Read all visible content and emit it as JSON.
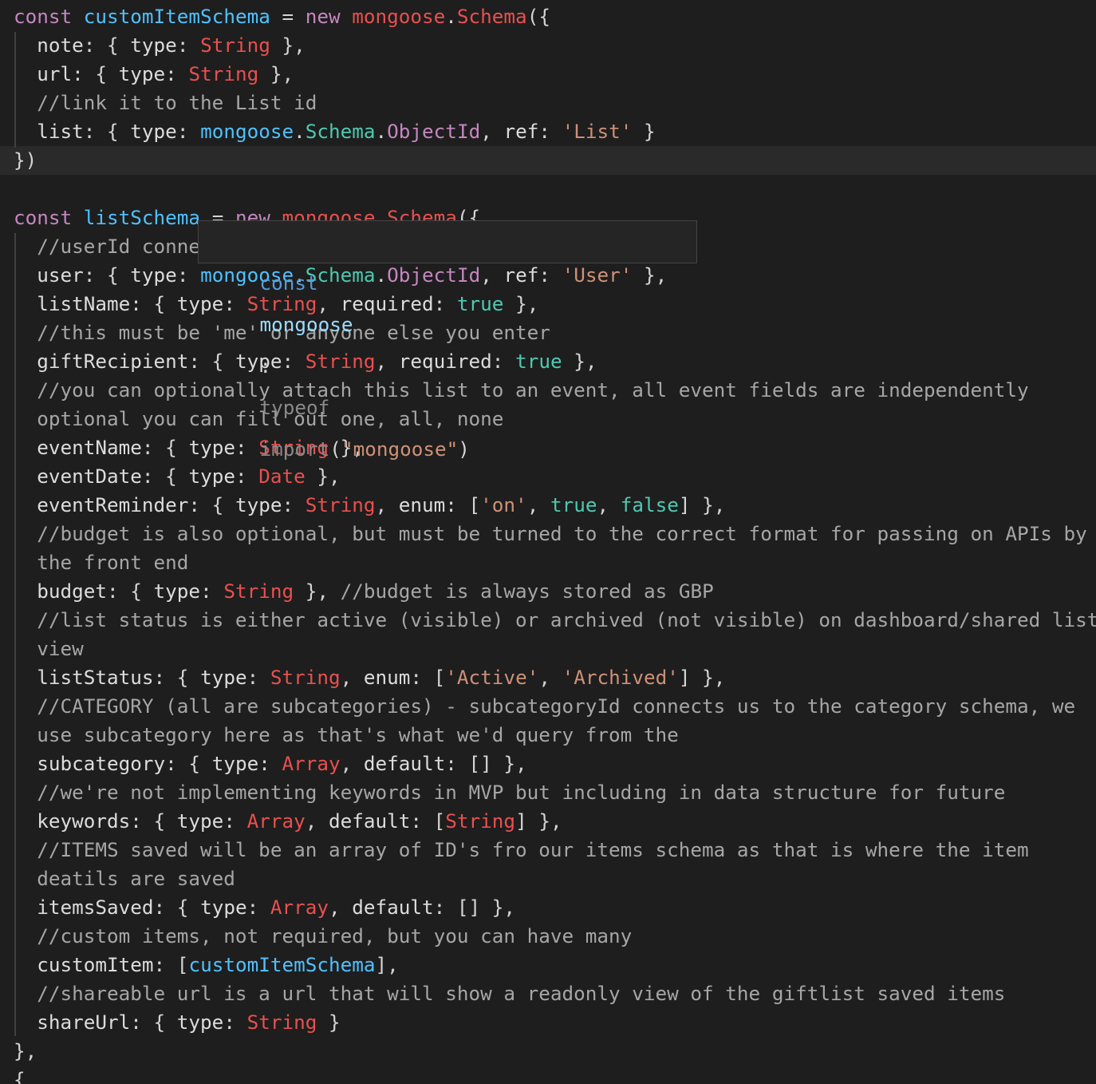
{
  "editor": {
    "lines": [
      [
        [
          "kw",
          "const "
        ],
        [
          "var",
          "customItemSchema"
        ],
        [
          "op",
          " = "
        ],
        [
          "kw",
          "new "
        ],
        [
          "cls",
          "mongoose"
        ],
        [
          "op",
          "."
        ],
        [
          "cls",
          "Schema"
        ],
        [
          "brk",
          "({"
        ]
      ],
      [
        [
          "prop",
          "  note"
        ],
        [
          "op",
          ": { "
        ],
        [
          "prop",
          "type"
        ],
        [
          "op",
          ": "
        ],
        [
          "cls",
          "String"
        ],
        [
          "op",
          " },"
        ]
      ],
      [
        [
          "prop",
          "  url"
        ],
        [
          "op",
          ": { "
        ],
        [
          "prop",
          "type"
        ],
        [
          "op",
          ": "
        ],
        [
          "cls",
          "String"
        ],
        [
          "op",
          " },"
        ]
      ],
      [
        [
          "cmt",
          "  //link it to the List id"
        ]
      ],
      [
        [
          "prop",
          "  list"
        ],
        [
          "op",
          ": { "
        ],
        [
          "prop",
          "type"
        ],
        [
          "op",
          ": "
        ],
        [
          "var",
          "mongoose"
        ],
        [
          "op",
          "."
        ],
        [
          "fn",
          "Schema"
        ],
        [
          "op",
          "."
        ],
        [
          "kw",
          "ObjectId"
        ],
        [
          "op",
          ", "
        ],
        [
          "prop",
          "ref"
        ],
        [
          "op",
          ": "
        ],
        [
          "str",
          "'List'"
        ],
        [
          "op",
          " }"
        ]
      ],
      [
        [
          "brk",
          "})"
        ]
      ],
      [],
      [
        [
          "kw",
          "const "
        ],
        [
          "var",
          "listSchema"
        ],
        [
          "op",
          " = "
        ],
        [
          "kw",
          "new "
        ],
        [
          "cls",
          "mongoose"
        ],
        [
          "op",
          "."
        ],
        [
          "cls",
          "Schema"
        ],
        [
          "brk",
          "({"
        ]
      ],
      [
        [
          "cmt",
          "  //userId connects us to the user schema"
        ]
      ],
      [
        [
          "prop",
          "  user"
        ],
        [
          "op",
          ": { "
        ],
        [
          "prop",
          "type"
        ],
        [
          "op",
          ": "
        ],
        [
          "var",
          "mongoose"
        ],
        [
          "op",
          "."
        ],
        [
          "fn",
          "Schema"
        ],
        [
          "op",
          "."
        ],
        [
          "kw",
          "ObjectId"
        ],
        [
          "op",
          ", "
        ],
        [
          "prop",
          "ref"
        ],
        [
          "op",
          ": "
        ],
        [
          "str",
          "'User'"
        ],
        [
          "op",
          " },"
        ]
      ],
      [
        [
          "prop",
          "  listName"
        ],
        [
          "op",
          ": { "
        ],
        [
          "prop",
          "type"
        ],
        [
          "op",
          ": "
        ],
        [
          "cls",
          "String"
        ],
        [
          "op",
          ", "
        ],
        [
          "prop",
          "required"
        ],
        [
          "op",
          ": "
        ],
        [
          "lit",
          "true"
        ],
        [
          "op",
          " },"
        ]
      ],
      [
        [
          "cmt",
          "  //this must be 'me' or anyone else you enter"
        ]
      ],
      [
        [
          "prop",
          "  giftRecipient"
        ],
        [
          "op",
          ": { "
        ],
        [
          "prop",
          "type"
        ],
        [
          "op",
          ": "
        ],
        [
          "cls",
          "String"
        ],
        [
          "op",
          ", "
        ],
        [
          "prop",
          "required"
        ],
        [
          "op",
          ": "
        ],
        [
          "lit",
          "true"
        ],
        [
          "op",
          " },"
        ]
      ],
      [
        [
          "cmt",
          "  //you can optionally attach this list to an event, all event fields are independently"
        ]
      ],
      [
        [
          "cmt",
          "  optional you can fill out one, all, none"
        ]
      ],
      [
        [
          "prop",
          "  eventName"
        ],
        [
          "op",
          ": { "
        ],
        [
          "prop",
          "type"
        ],
        [
          "op",
          ": "
        ],
        [
          "cls",
          "String"
        ],
        [
          "op",
          " },"
        ]
      ],
      [
        [
          "prop",
          "  eventDate"
        ],
        [
          "op",
          ": { "
        ],
        [
          "prop",
          "type"
        ],
        [
          "op",
          ": "
        ],
        [
          "cls",
          "Date"
        ],
        [
          "op",
          " },"
        ]
      ],
      [
        [
          "prop",
          "  eventReminder"
        ],
        [
          "op",
          ": { "
        ],
        [
          "prop",
          "type"
        ],
        [
          "op",
          ": "
        ],
        [
          "cls",
          "String"
        ],
        [
          "op",
          ", "
        ],
        [
          "prop",
          "enum"
        ],
        [
          "op",
          ": ["
        ],
        [
          "str",
          "'on'"
        ],
        [
          "op",
          ", "
        ],
        [
          "lit",
          "true"
        ],
        [
          "op",
          ", "
        ],
        [
          "lit",
          "false"
        ],
        [
          "op",
          "] },"
        ]
      ],
      [
        [
          "cmt",
          "  //budget is also optional, but must be turned to the correct format for passing on APIs by"
        ]
      ],
      [
        [
          "cmt",
          "  the front end"
        ]
      ],
      [
        [
          "prop",
          "  budget"
        ],
        [
          "op",
          ": { "
        ],
        [
          "prop",
          "type"
        ],
        [
          "op",
          ": "
        ],
        [
          "cls",
          "String"
        ],
        [
          "op",
          " }, "
        ],
        [
          "cmt",
          "//budget is always stored as GBP"
        ]
      ],
      [
        [
          "cmt",
          "  //list status is either active (visible) or archived (not visible) on dashboard/shared list"
        ]
      ],
      [
        [
          "cmt",
          "  view"
        ]
      ],
      [
        [
          "prop",
          "  listStatus"
        ],
        [
          "op",
          ": { "
        ],
        [
          "prop",
          "type"
        ],
        [
          "op",
          ": "
        ],
        [
          "cls",
          "String"
        ],
        [
          "op",
          ", "
        ],
        [
          "prop",
          "enum"
        ],
        [
          "op",
          ": ["
        ],
        [
          "str",
          "'Active'"
        ],
        [
          "op",
          ", "
        ],
        [
          "str",
          "'Archived'"
        ],
        [
          "op",
          "] },"
        ]
      ],
      [
        [
          "cmt",
          "  //CATEGORY (all are subcategories) - subcategoryId connects us to the category schema, we"
        ]
      ],
      [
        [
          "cmt",
          "  use subcategory here as that's what we'd query from the"
        ]
      ],
      [
        [
          "prop",
          "  subcategory"
        ],
        [
          "op",
          ": { "
        ],
        [
          "prop",
          "type"
        ],
        [
          "op",
          ": "
        ],
        [
          "cls",
          "Array"
        ],
        [
          "op",
          ", "
        ],
        [
          "prop",
          "default"
        ],
        [
          "op",
          ": [] },"
        ]
      ],
      [
        [
          "cmt",
          "  //we're not implementing keywords in MVP but including in data structure for future"
        ]
      ],
      [
        [
          "prop",
          "  keywords"
        ],
        [
          "op",
          ": { "
        ],
        [
          "prop",
          "type"
        ],
        [
          "op",
          ": "
        ],
        [
          "cls",
          "Array"
        ],
        [
          "op",
          ", "
        ],
        [
          "prop",
          "default"
        ],
        [
          "op",
          ": ["
        ],
        [
          "cls",
          "String"
        ],
        [
          "op",
          "] },"
        ]
      ],
      [
        [
          "cmt",
          "  //ITEMS saved will be an array of ID's fro our items schema as that is where the item"
        ]
      ],
      [
        [
          "cmt",
          "  deatils are saved"
        ]
      ],
      [
        [
          "prop",
          "  itemsSaved"
        ],
        [
          "op",
          ": { "
        ],
        [
          "prop",
          "type"
        ],
        [
          "op",
          ": "
        ],
        [
          "cls",
          "Array"
        ],
        [
          "op",
          ", "
        ],
        [
          "prop",
          "default"
        ],
        [
          "op",
          ": [] },"
        ]
      ],
      [
        [
          "cmt",
          "  //custom items, not required, but you can have many"
        ]
      ],
      [
        [
          "prop",
          "  customItem"
        ],
        [
          "op",
          ": ["
        ],
        [
          "var",
          "customItemSchema"
        ],
        [
          "op",
          "],"
        ]
      ],
      [
        [
          "cmt",
          "  //shareable url is a url that will show a readonly view of the giftlist saved items"
        ]
      ],
      [
        [
          "prop",
          "  shareUrl"
        ],
        [
          "op",
          ": { "
        ],
        [
          "prop",
          "type"
        ],
        [
          "op",
          ": "
        ],
        [
          "cls",
          "String"
        ],
        [
          "op",
          " }"
        ]
      ],
      [
        [
          "brk",
          "},"
        ]
      ],
      [
        [
          "brk",
          "{"
        ]
      ]
    ]
  },
  "tooltip": {
    "keyword": "const",
    "name": "mongoose",
    "colon": ":",
    "type_kw": "typeof",
    "import_kw": "import",
    "open": "(",
    "module": "\"mongoose\"",
    "close": ")"
  },
  "colors": {
    "background": "#1e1e1e",
    "current_line": "#2a2a2a",
    "keyword": "#c586c0",
    "variable": "#4fc1ff",
    "class": "#e9504f",
    "string": "#ce9178",
    "literal": "#4ec9b0",
    "comment": "#a6a6a6"
  }
}
